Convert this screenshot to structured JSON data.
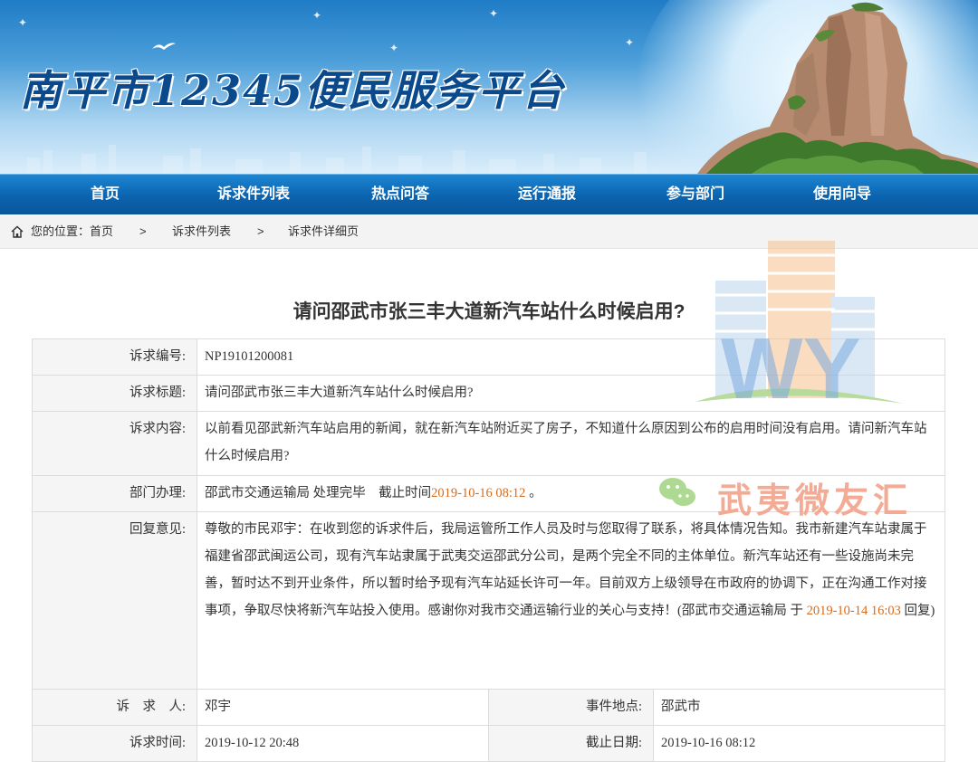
{
  "site": {
    "title": "南平市12345便民服务平台"
  },
  "nav": [
    {
      "label": "首页"
    },
    {
      "label": "诉求件列表"
    },
    {
      "label": "热点问答"
    },
    {
      "label": "运行通报"
    },
    {
      "label": "参与部门"
    },
    {
      "label": "使用向导"
    }
  ],
  "breadcrumb": {
    "prefix": "您的位置：首页",
    "sep": ">",
    "items": [
      "诉求件列表",
      "诉求件详细页"
    ]
  },
  "watermark": {
    "text": "武夷微友汇",
    "logo_letters": "WY"
  },
  "page_title": "请问邵武市张三丰大道新汽车站什么时候启用?",
  "detail": {
    "id_label": "诉求编号:",
    "id_value": "NP19101200081",
    "subject_label": "诉求标题:",
    "subject_value": "请问邵武市张三丰大道新汽车站什么时候启用?",
    "content_label": "诉求内容:",
    "content_value": "以前看见邵武新汽车站启用的新闻，就在新汽车站附近买了房子，不知道什么原因到公布的启用时间没有启用。请问新汽车站什么时候启用?",
    "dept_label": "部门办理:",
    "dept_value": "邵武市交通运输局 处理完毕　截止时间",
    "dept_deadline": "2019-10-16 08:12",
    "dept_end": " 。",
    "reply_label": "回复意见:",
    "reply_text": "尊敬的市民邓宇：在收到您的诉求件后，我局运管所工作人员及时与您取得了联系，将具体情况告知。我市新建汽车站隶属于福建省邵武闽运公司，现有汽车站隶属于武夷交运邵武分公司，是两个完全不同的主体单位。新汽车站还有一些设施尚未完善，暂时达不到开业条件，所以暂时给予现有汽车站延长许可一年。目前双方上级领导在市政府的协调下，正在沟通工作对接事项，争取尽快将新汽车站投入使用。感谢你对我市交通运输行业的关心与支持！(邵武市交通运输局 于 ",
    "reply_time": " 2019-10-14 16:03",
    "reply_end": " 回复)",
    "person_label": "诉　求　人:",
    "person_value": "邓宇",
    "place_label": "事件地点:",
    "place_value": "邵武市",
    "time_label": "诉求时间:",
    "time_value": "2019-10-12 20:48",
    "deadline_label": "截止日期:",
    "deadline_value": "2019-10-16 08:12"
  },
  "colors": {
    "nav_bg": "#0b63ae",
    "highlight": "#d76b1d",
    "title_blue": "#0a4a8c"
  }
}
